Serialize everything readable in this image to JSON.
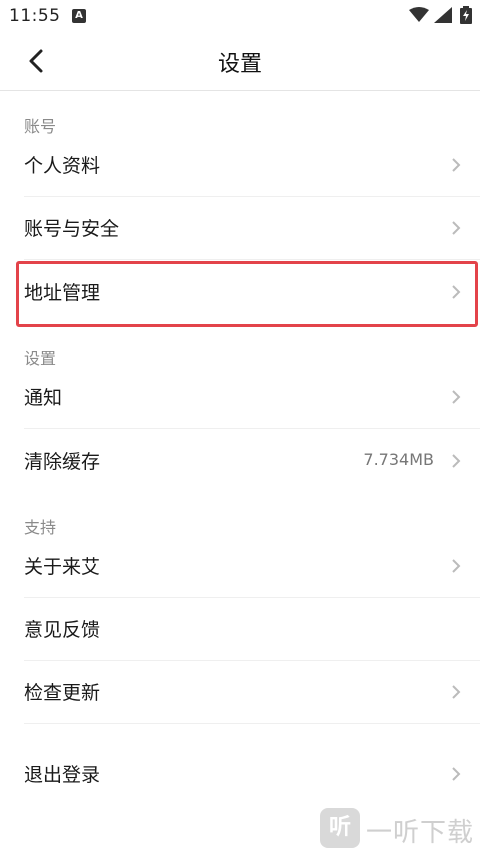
{
  "status_bar": {
    "time": "11:55",
    "notification_letter": "A"
  },
  "header": {
    "title": "设置"
  },
  "sections": [
    {
      "label": "账号",
      "items": [
        {
          "label": "个人资料",
          "value": "",
          "chevron": true
        },
        {
          "label": "账号与安全",
          "value": "",
          "chevron": true
        },
        {
          "label": "地址管理",
          "value": "",
          "chevron": true,
          "highlighted": true
        }
      ]
    },
    {
      "label": "设置",
      "items": [
        {
          "label": "通知",
          "value": "",
          "chevron": true
        },
        {
          "label": "清除缓存",
          "value": "7.734MB",
          "chevron": true
        }
      ]
    },
    {
      "label": "支持",
      "items": [
        {
          "label": "关于来艾",
          "value": "",
          "chevron": true
        },
        {
          "label": "意见反馈",
          "value": "",
          "chevron": false
        },
        {
          "label": "检查更新",
          "value": "",
          "chevron": true
        }
      ]
    }
  ],
  "logout": {
    "label": "退出登录"
  },
  "watermark": {
    "icon_text": "听",
    "text": "一听下载"
  },
  "colors": {
    "highlight": "#e3434a",
    "divider": "#efefef",
    "section_label": "#8a8a8a"
  }
}
